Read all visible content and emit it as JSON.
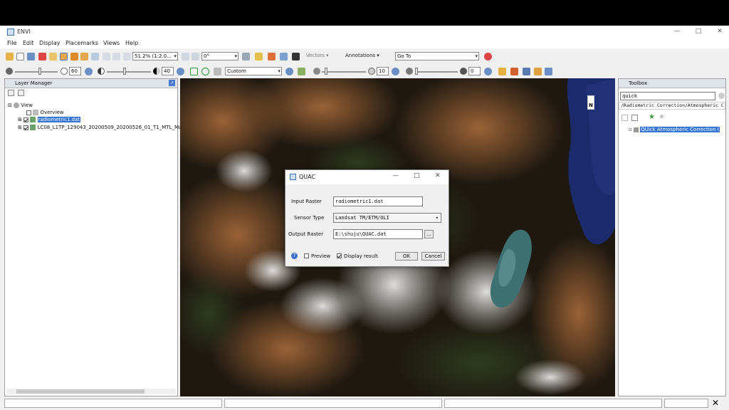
{
  "app": {
    "title": "ENVI"
  },
  "menu": [
    "File",
    "Edit",
    "Display",
    "Placemarks",
    "Views",
    "Help"
  ],
  "toolbar1": {
    "zoom": "51.2% (1:2.0...",
    "rotation": "0°",
    "vectors": "Vectors",
    "annotations": "Annotations",
    "goto": "Go To"
  },
  "toolbar2": {
    "brightness": "60",
    "contrast": "40",
    "stretch": "Custom",
    "sharpen": "10",
    "transparency": "0"
  },
  "layer_manager": {
    "title": "Layer Manager",
    "view": "View",
    "overview": "Overview",
    "layers": [
      "radiometric1.dat",
      "LC08_L1TP_129043_20200509_20200526_01_T1_MTL_Mu"
    ]
  },
  "image": {
    "north": "N"
  },
  "toolbox": {
    "title": "Toolbox",
    "search": "quick",
    "path": "/Radiometric Correction/Atmospheric C",
    "result": "QUick Atmospheric Correction ("
  },
  "dialog": {
    "title": "QUAC",
    "input_label": "Input Raster",
    "input_value": "radiometric1.dat",
    "sensor_label": "Sensor Type",
    "sensor_value": "Landsat TM/ETM/OLI",
    "output_label": "Output Raster",
    "output_value": "E:\\shuju\\QUAC.dat",
    "browse": "...",
    "preview": "Preview",
    "display_result": "Display result",
    "ok": "OK",
    "cancel": "Cancel"
  }
}
